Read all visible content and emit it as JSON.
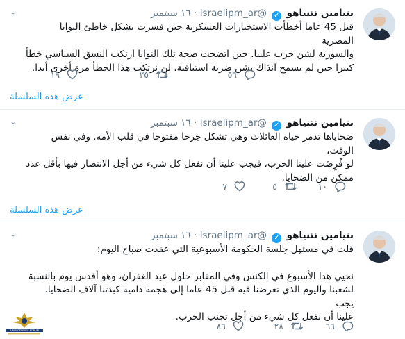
{
  "tweets": [
    {
      "name": "بنيامين نتنياهو",
      "handle": "@Israelipm_ar",
      "dot": "·",
      "time": "١٦ سبتمبر",
      "lines": [
        "قبل 45 عاما أخطأت الاستخبارات العسكرية حين فسرت بشكل خاطئ النوايا المصرية",
        "والسورية لشن حرب علينا. حين اتضحت صحة تلك النوايا ارتكب النسق السياسي خطأ",
        "كبيرا حين لم يسمح آنذاك بشن ضربة استباقية. لن نرتكب هذا الخطأ مرة أخرى أبدا."
      ],
      "replies": "٥٦",
      "retweets": "٢٥",
      "likes": "١٩",
      "thread_link": "عرض هذه السلسلة"
    },
    {
      "name": "بنيامين نتنياهو",
      "handle": "@Israelipm_ar",
      "dot": "·",
      "time": "١٦ سبتمبر",
      "lines": [
        "ضحاياها تدمر حياة العائلات وهي تشكل جرحا مفتوحا في قلب الأمة. وفي نفس الوقت،",
        "لو فُرِضَت علينا الحرب، فيجب علينا أن نفعل كل شيء من أجل الانتصار فيها بأقل عدد",
        "ممكن من الضحايا."
      ],
      "replies": "١٠",
      "retweets": "٥",
      "likes": "٧",
      "thread_link": "عرض هذه السلسلة"
    },
    {
      "name": "بنيامين نتنياهو",
      "handle": "@Israelipm_ar",
      "dot": "·",
      "time": "١٦ سبتمبر",
      "intro": "قلت في مستهل جلسة الحكومة الأسبوعية التي عقدت صباح اليوم:",
      "lines": [
        "نحيي هذا الأسبوع في الكنس وفي المقابر حلول عيد الغفران، وهو أقدس يوم بالنسبة",
        "لشعبنا واليوم الذي تعرضنا فيه قبل 45 عاما إلى هجمة دامية كبدتنا آلاف الضحايا. يجب",
        "علينا أن نفعل كل شيء من أجل تجنب الحرب."
      ],
      "replies": "٦٦",
      "retweets": "٢٨",
      "likes": "٨٦"
    }
  ],
  "watermark": {
    "text": "ARAB DEFENSE FORUM",
    "subtext": "المنتدى العربي للدفاع والتسليح"
  },
  "colors": {
    "text": "#14171a",
    "muted": "#657786",
    "link": "#1da1f2",
    "border": "#e6ecf0"
  }
}
